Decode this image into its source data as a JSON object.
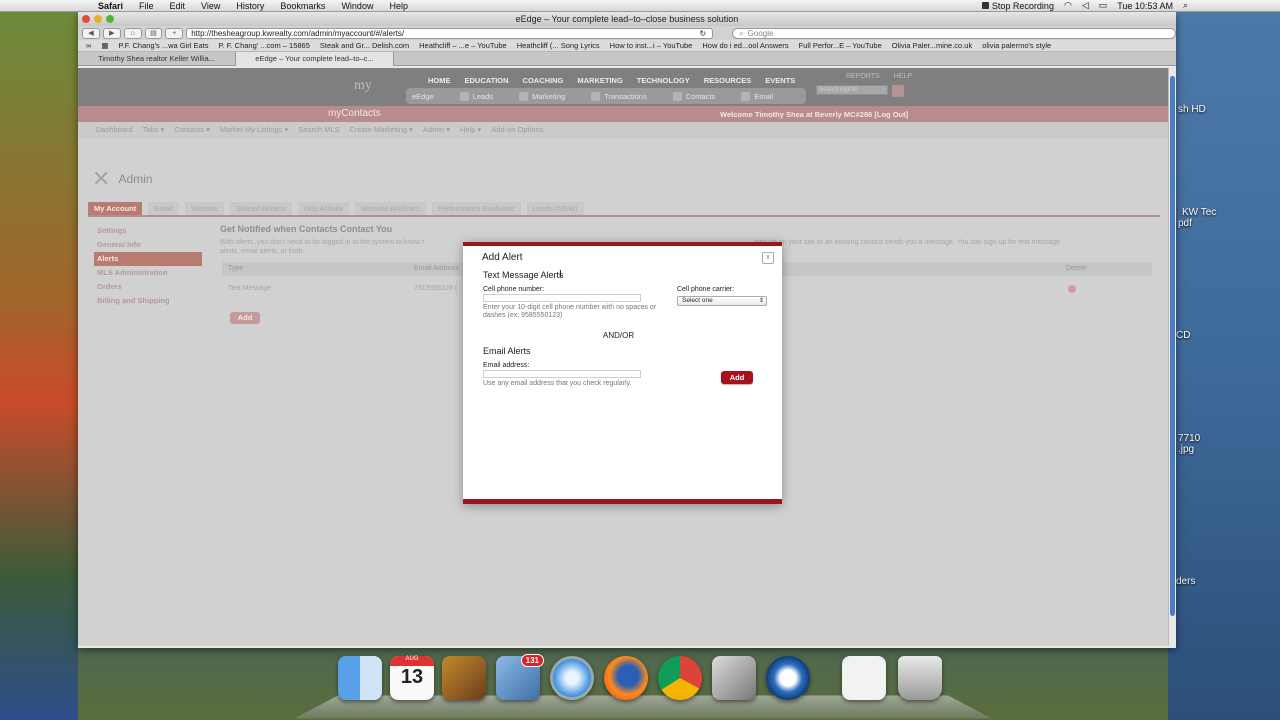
{
  "menubar": {
    "apple": "",
    "items": [
      "Safari",
      "File",
      "Edit",
      "View",
      "History",
      "Bookmarks",
      "Window",
      "Help"
    ],
    "stop_recording": "Stop Recording",
    "clock": "Tue 10:53 AM"
  },
  "window": {
    "title": "eEdge – Your complete lead–to–close business solution",
    "url": "http://thesheagroup.kwrealty.com/admin/myaccount/#/alerts/",
    "search_placeholder": "Google"
  },
  "bookmarks": [
    "P.F. Chang's ...wa Girl Eats",
    "P. F. Chang' ...com – 15865",
    "Steak and Gr... Delish.com",
    "Heathcliff – ...e – YouTube",
    "Heathcliff (... Song Lyrics",
    "How to inst...i – YouTube",
    "How do i ed...ool Answers",
    "Full Perfor...E – YouTube",
    "Olivia Paler...mine.co.uk",
    "olivia palermo's style"
  ],
  "tabs": [
    "Timothy Shea realtor Keller Willia...",
    "eEdge – Your complete lead–to–c..."
  ],
  "kw": {
    "logo": "my",
    "nav": [
      "HOME",
      "EDUCATION",
      "COACHING",
      "MARKETING",
      "TECHNOLOGY",
      "RESOURCES",
      "EVENTS"
    ],
    "nav_right": [
      "REPORTS",
      "HELP"
    ],
    "subnav": [
      "eEdge",
      "Leads",
      "Marketing",
      "Transactions",
      "Contacts",
      "Email"
    ],
    "search_placeholder": "Search myKW"
  },
  "app_bar": {
    "title": "myContacts",
    "welcome": "Welcome Timothy Shea at Beverly MC#286",
    "logout": "[Log Out]"
  },
  "menu2": [
    "Dashboard",
    "Tabs ▾",
    "Contacts ▾",
    "Market My Listings ▾",
    "Search MLS",
    "Create Marketing ▾",
    "Admin ▾",
    "Help ▾",
    "Add-on Options"
  ],
  "admin_title": "Admin",
  "page_tabs": [
    "My Account",
    "Email",
    "Website",
    "Shared Access",
    "Drip Activity",
    "Website Analytics",
    "Performance Evaluator",
    "Leads (NEW)"
  ],
  "sidebar": [
    "Settings",
    "General Info",
    "Alerts",
    "MLS Administration",
    "Orders",
    "Billing and Shipping"
  ],
  "content": {
    "heading": "Get Notified when Contacts Contact You",
    "desc_left": "With alerts, you don't need to be logged in to the system to know t",
    "desc_right": "igns up on your site or an existing contact sends you a message. You can sign up for text message",
    "desc_line2": "alerts, email alerts, or both.",
    "col_type": "Type",
    "col_email": "Email Address",
    "col_delete": "Delete",
    "row_type": "Text Message",
    "row_phone": "7613995128 (",
    "add": "Add"
  },
  "modal": {
    "title": "Add Alert",
    "close": "x",
    "text_section": "Text Message Alerts",
    "cell_label": "Cell phone number:",
    "cell_hint": "Enter your 10-digit cell phone number with no spaces or dashes (ex: 9585550123)",
    "carrier_label": "Cell phone carrier:",
    "carrier_value": "Select one",
    "andor": "AND/OR",
    "email_section": "Email Alerts",
    "email_label": "Email address:",
    "email_hint": "Use any email address that you check regularly.",
    "add": "Add"
  },
  "desktop": [
    "sh HD",
    "KW Tec",
    "pdf",
    "CD",
    "7710",
    ".jpg",
    "ders"
  ],
  "dock": {
    "calendar_day": "13",
    "calendar_month": "AUG",
    "mail_badge": "131"
  }
}
